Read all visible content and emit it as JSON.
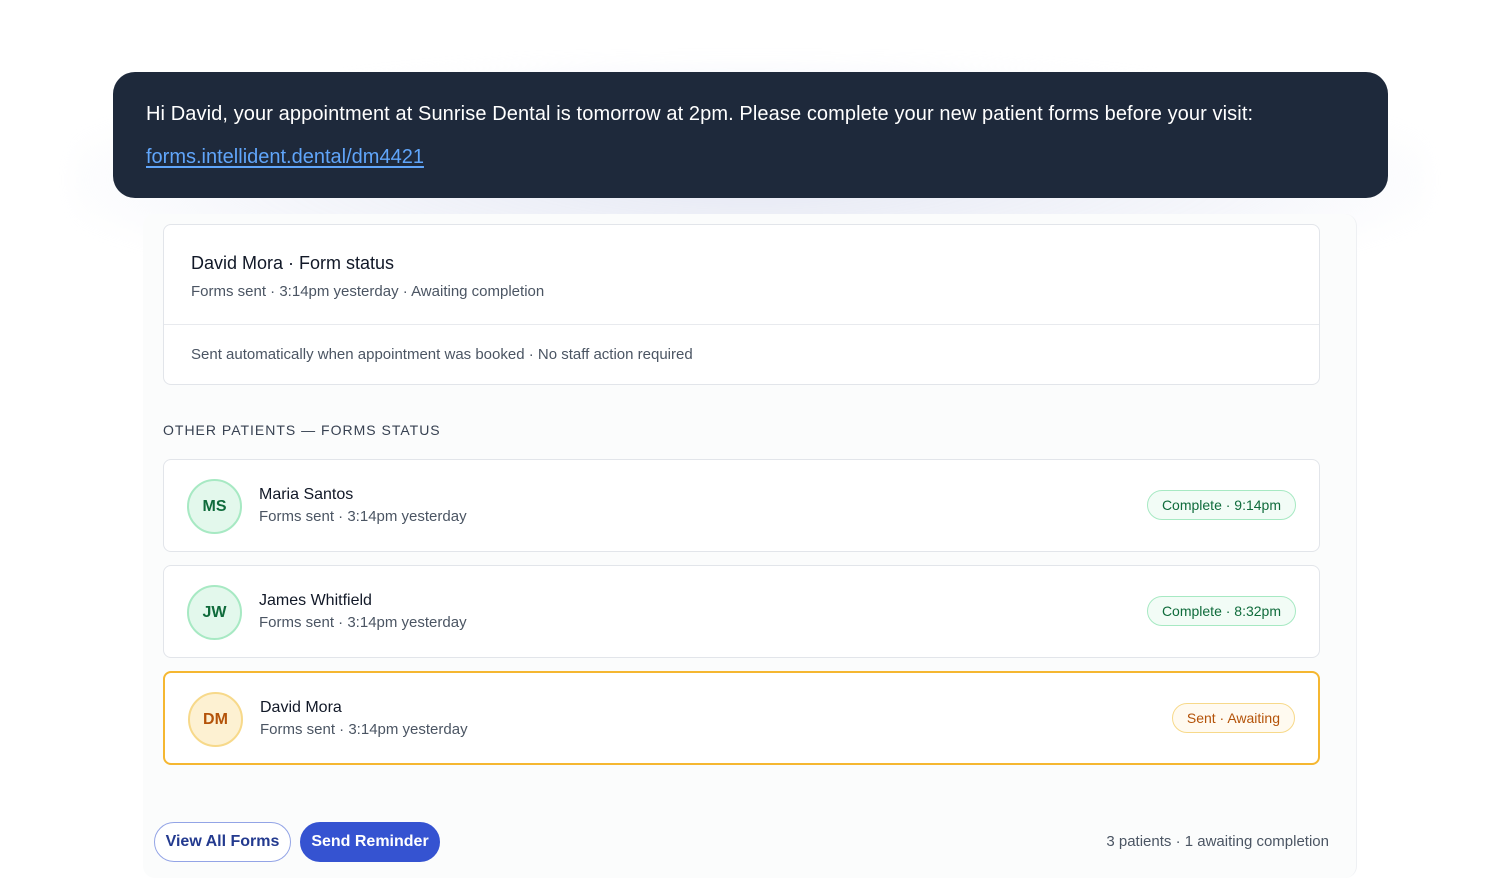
{
  "message": {
    "text": "Hi David, your appointment at Sunrise Dental is tomorrow at 2pm. Please complete your new patient forms before your visit:",
    "link": "forms.intellident.dental/dm4421"
  },
  "status_card": {
    "title": "David Mora · Form status",
    "subtitle": "Forms sent · 3:14pm yesterday · Awaiting completion",
    "note": "Sent automatically when appointment was booked · No staff action required"
  },
  "section": {
    "heading": "OTHER PATIENTS — FORMS STATUS"
  },
  "patients": [
    {
      "initials": "MS",
      "name": "Maria Santos",
      "sub": "Forms sent · 3:14pm yesterday",
      "badge": "Complete · 9:14pm",
      "status": "complete"
    },
    {
      "initials": "JW",
      "name": "James Whitfield",
      "sub": "Forms sent · 3:14pm yesterday",
      "badge": "Complete · 8:32pm",
      "status": "complete"
    },
    {
      "initials": "DM",
      "name": "David Mora",
      "sub": "Forms sent · 3:14pm yesterday",
      "badge": "Sent · Awaiting",
      "status": "awaiting"
    }
  ],
  "actions": {
    "view_all_label": "View All Forms",
    "send_reminder_label": "Send Reminder"
  },
  "footer": {
    "summary": "3 patients · 1 awaiting completion"
  },
  "colors": {
    "message_bg": "#1e293b",
    "link": "#60a5fa",
    "complete": "#0f6b3b",
    "awaiting": "#b45309",
    "highlight_border": "#f5b731",
    "primary": "#3553d1"
  }
}
